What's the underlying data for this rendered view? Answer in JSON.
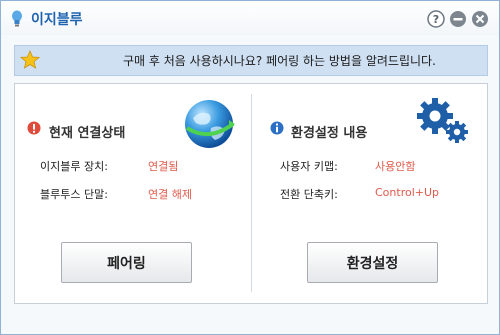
{
  "window": {
    "title": "이지블루"
  },
  "notice": {
    "text": "구매 후 처음 사용하시나요? 페어링 하는 방법을 알려드립니다."
  },
  "left_section": {
    "heading": "현재 연결상태",
    "rows": [
      {
        "label": "이지블루 장치:",
        "value": "연결됨"
      },
      {
        "label": "블루투스 단말:",
        "value": "연결 해제"
      }
    ],
    "button": "페어링"
  },
  "right_section": {
    "heading": "환경설정 내용",
    "rows": [
      {
        "label": "사용자 키맵:",
        "value": "사용안함"
      },
      {
        "label": "전환 단축키:",
        "value": "Control+Up"
      }
    ],
    "button": "환경설정"
  },
  "colors": {
    "accent": "#1f63b0",
    "status_red": "#e05a4a",
    "notice_bg": "#cfe0f3"
  },
  "icons": [
    "bulb-icon",
    "help-icon",
    "minimize-icon",
    "close-icon",
    "star-icon",
    "alert-icon",
    "info-icon",
    "globe-icon",
    "gear-icon"
  ]
}
